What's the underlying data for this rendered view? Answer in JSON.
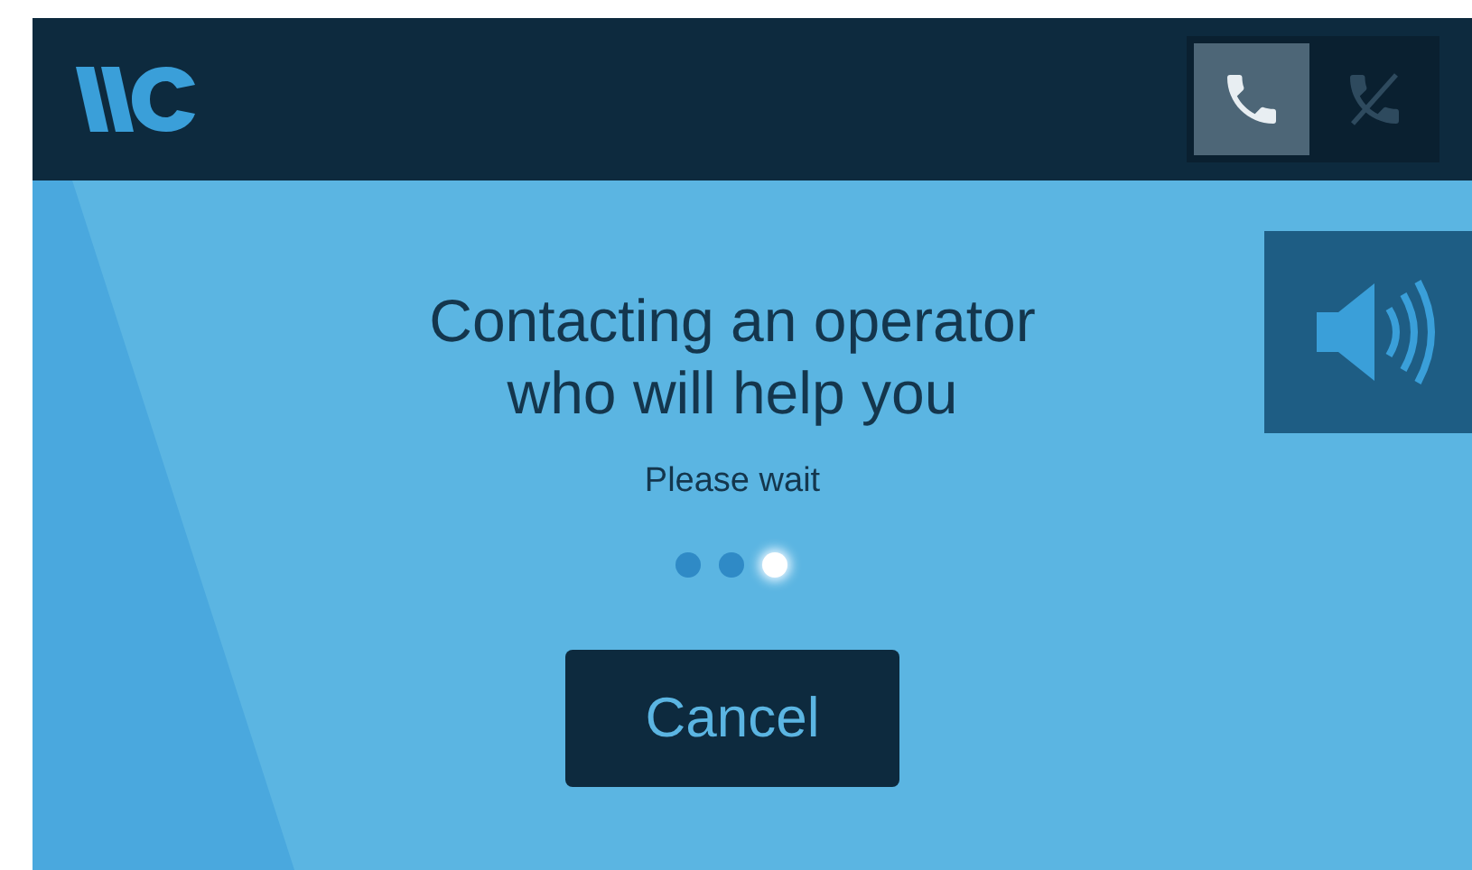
{
  "header": {
    "call_buttons": [
      {
        "kind": "answer",
        "selected": true
      },
      {
        "kind": "hangup",
        "selected": false
      }
    ]
  },
  "message": {
    "title_lines": [
      "Contacting an operator",
      "who will help you"
    ],
    "subtitle": "Please wait"
  },
  "loading_dots": [
    {
      "selected": false
    },
    {
      "selected": false
    },
    {
      "selected": true
    }
  ],
  "buttons": [
    {
      "label": "Cancel"
    }
  ]
}
